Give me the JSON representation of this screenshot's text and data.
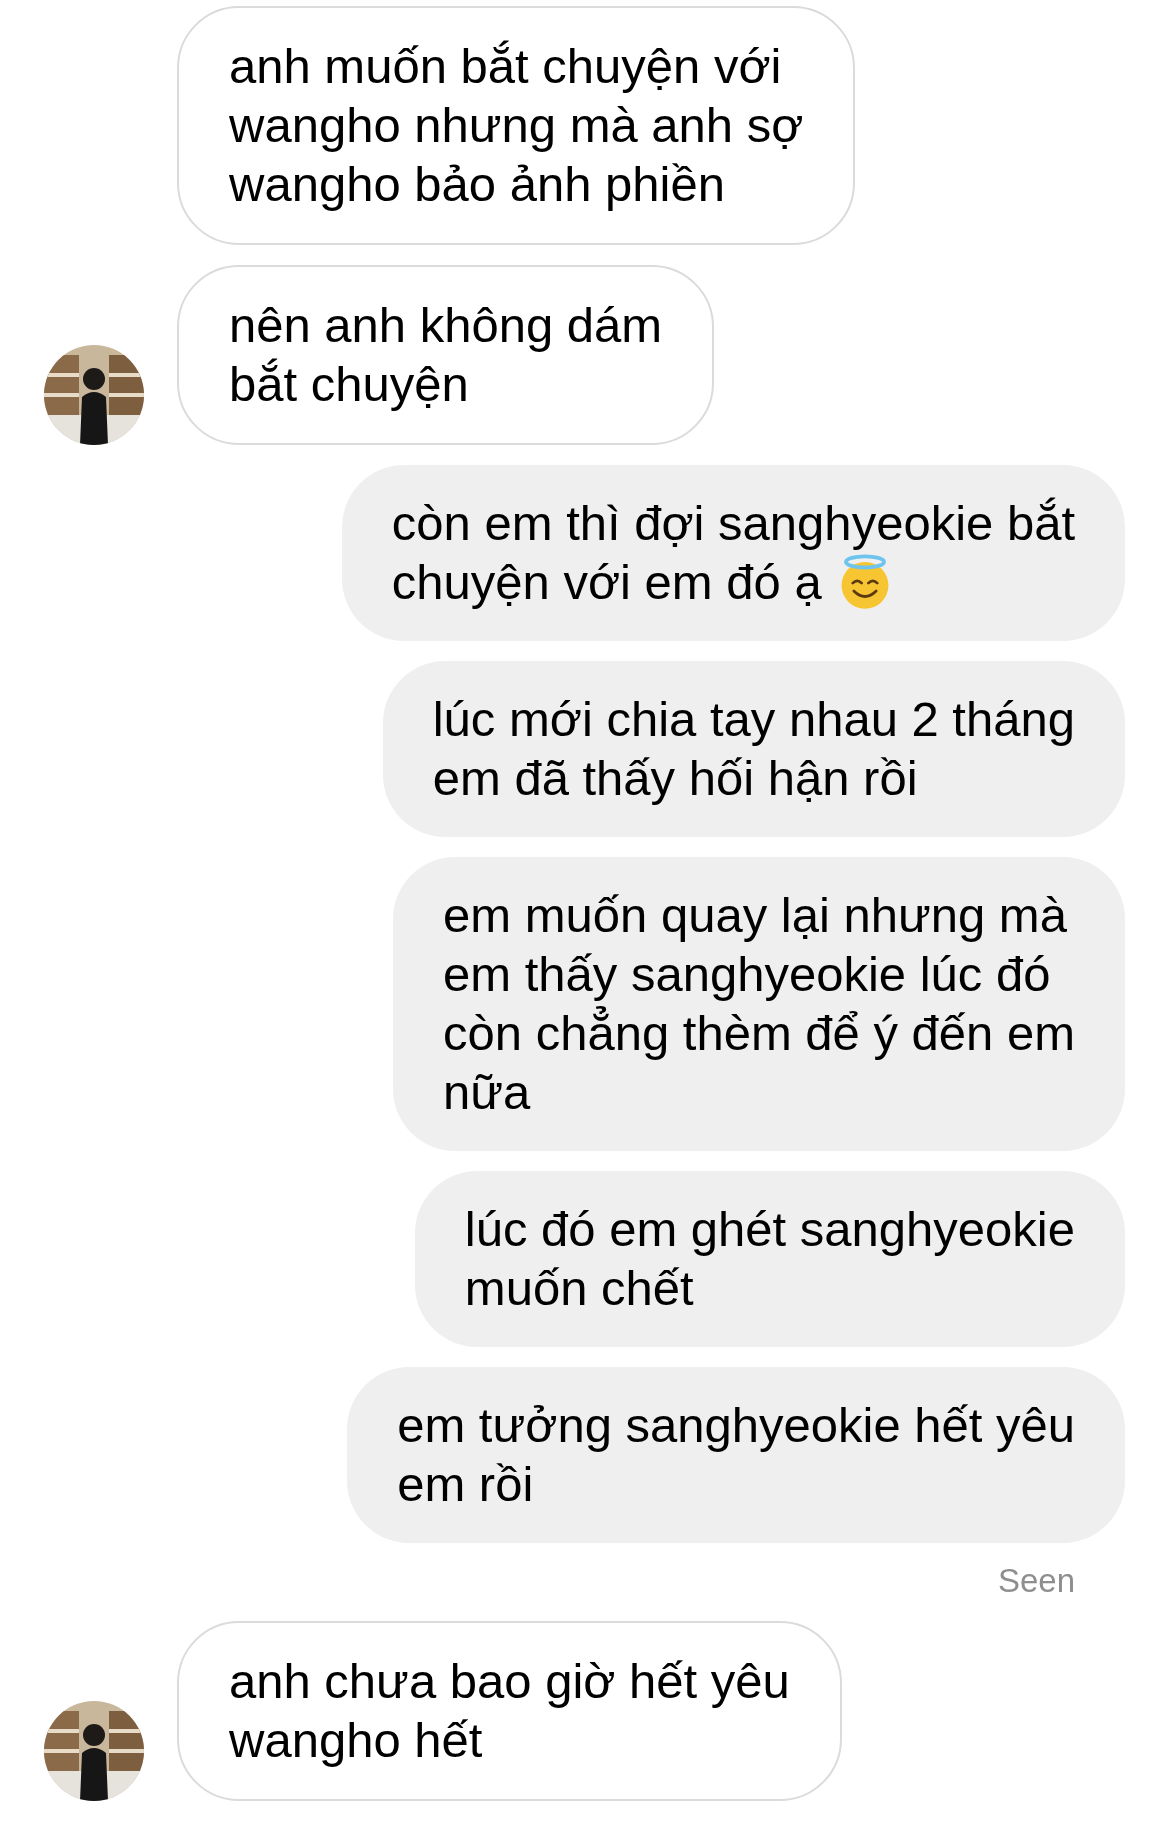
{
  "messages": [
    {
      "kind": "received",
      "text": "anh muốn bắt chuyện với\nwangho nhưng mà anh sợ\nwangho bảo ảnh phiền",
      "avatar": false,
      "trailing_icon": false
    },
    {
      "kind": "received",
      "text": "nên anh không dám\nbắt chuyện",
      "avatar": true,
      "trailing_icon": false
    },
    {
      "kind": "sent",
      "text": "còn em thì đợi sanghyeokie bắt\nchuyện với em đó ạ",
      "avatar": false,
      "trailing_icon": true
    },
    {
      "kind": "sent",
      "text": "lúc mới chia tay nhau 2 tháng\nem đã thấy hối hận rồi",
      "avatar": false,
      "trailing_icon": false
    },
    {
      "kind": "sent",
      "text": "em muốn quay lại nhưng mà\nem thấy sanghyeokie lúc đó\ncòn chẳng thèm để ý đến em\nnữa",
      "avatar": false,
      "trailing_icon": false
    },
    {
      "kind": "sent",
      "text": "lúc đó em ghét sanghyeokie\nmuốn chết",
      "avatar": false,
      "trailing_icon": false
    },
    {
      "kind": "sent",
      "text": "em tưởng sanghyeokie hết yêu\nem rồi",
      "avatar": false,
      "trailing_icon": false
    },
    {
      "kind": "status",
      "text": "Seen",
      "avatar": false,
      "trailing_icon": false
    },
    {
      "kind": "received",
      "text": "anh chưa bao giờ hết yêu\nwangho hết",
      "avatar": true,
      "trailing_icon": false
    }
  ]
}
